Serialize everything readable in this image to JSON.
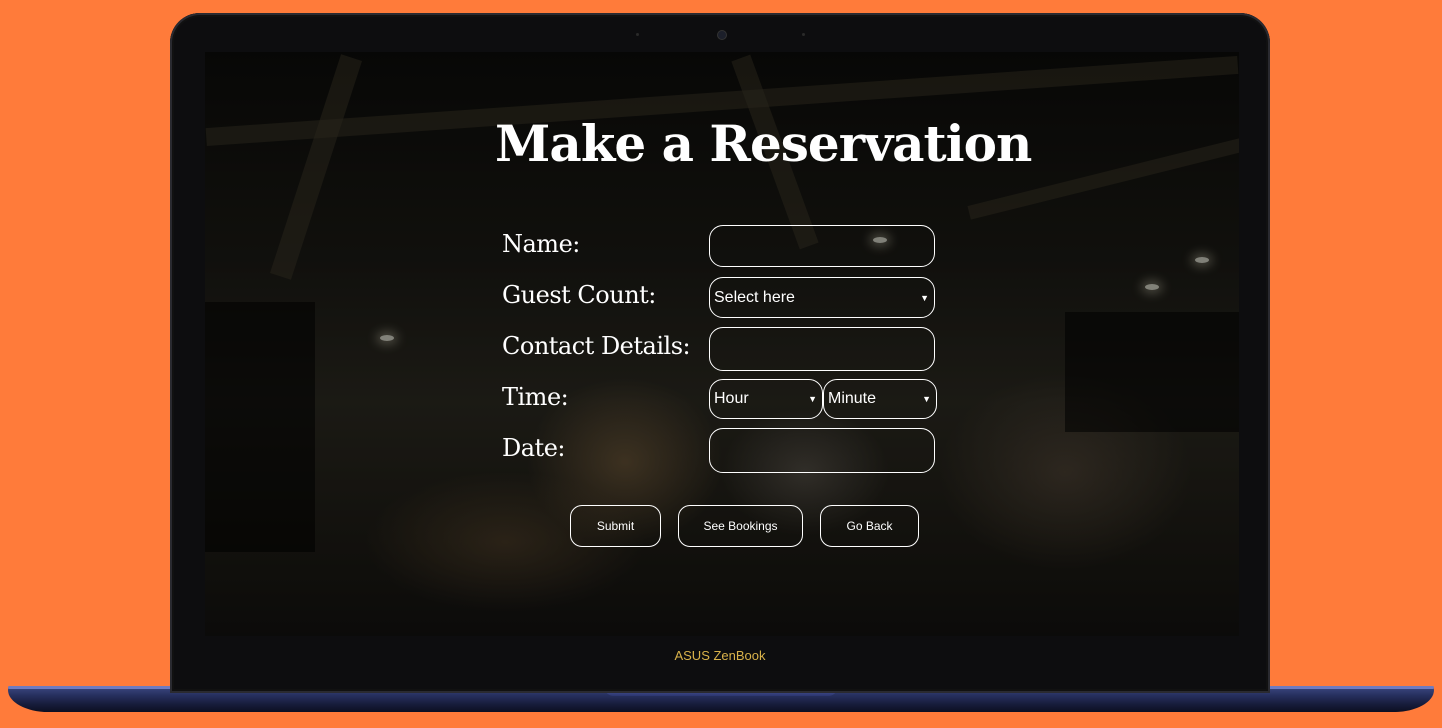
{
  "form": {
    "title": "Make a Reservation",
    "labels": {
      "name": "Name:",
      "guest_count": "Guest Count:",
      "contact": "Contact Details:",
      "time": "Time:",
      "date": "Date:"
    },
    "fields": {
      "name_value": "",
      "guest_count_selected": "Select here",
      "contact_value": "",
      "hour_selected": "Hour",
      "minute_selected": "Minute",
      "date_value": ""
    },
    "buttons": {
      "submit": "Submit",
      "see_bookings": "See Bookings",
      "go_back": "Go Back"
    }
  },
  "device": {
    "brand_text": "ASUS ZenBook"
  },
  "colors": {
    "background": "#ff7b3a",
    "brand": "#d9b24a",
    "form_text": "#ffffff"
  }
}
